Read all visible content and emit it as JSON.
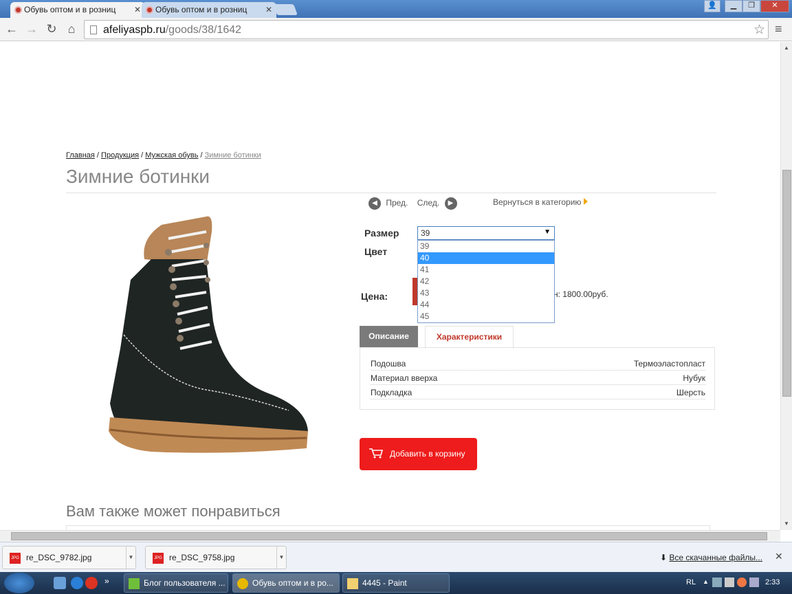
{
  "browser": {
    "tabs": [
      {
        "label": "Обувь оптом и в розниц",
        "active": true
      },
      {
        "label": "Обувь оптом и в розниц",
        "active": false
      }
    ],
    "url_host": "afeliyaspb.ru",
    "url_path": "/goods/38/1642"
  },
  "page": {
    "breadcrumbs": [
      "Главная",
      "Продукция",
      "Мужская обувь",
      "Зимние ботинки"
    ],
    "title": "Зимние ботинки",
    "prev_label": "Пред.",
    "next_label": "След.",
    "back_label": "Вернуться в категорию",
    "size_label": "Размер",
    "color_label": "Цвет",
    "price_label": "Цена:",
    "size_selected": "39",
    "size_options": [
      "39",
      "40",
      "41",
      "42",
      "43",
      "44",
      "45"
    ],
    "size_highlighted": "40",
    "price_text": "н: 1800.00руб.",
    "tab_description": "Описание",
    "tab_characteristics": "Характеристики",
    "specs": [
      {
        "key": "Подошва",
        "value": "Термоэластопласт"
      },
      {
        "key": "Материал вверха",
        "value": "Нубук"
      },
      {
        "key": "Подкладка",
        "value": "Шерсть"
      }
    ],
    "add_to_cart": "Добавить в корзину",
    "also_like": "Вам также может понравиться"
  },
  "downloads": {
    "files": [
      "re_DSC_9782.jpg",
      "re_DSC_9758.jpg"
    ],
    "file_icon": "JPG",
    "all_files": "Все скачанные файлы..."
  },
  "taskbar": {
    "tasks": [
      "Блог пользователя ...",
      "Обувь оптом и в ро...",
      "4445 - Paint"
    ],
    "language": "RL",
    "time": "2:33"
  }
}
